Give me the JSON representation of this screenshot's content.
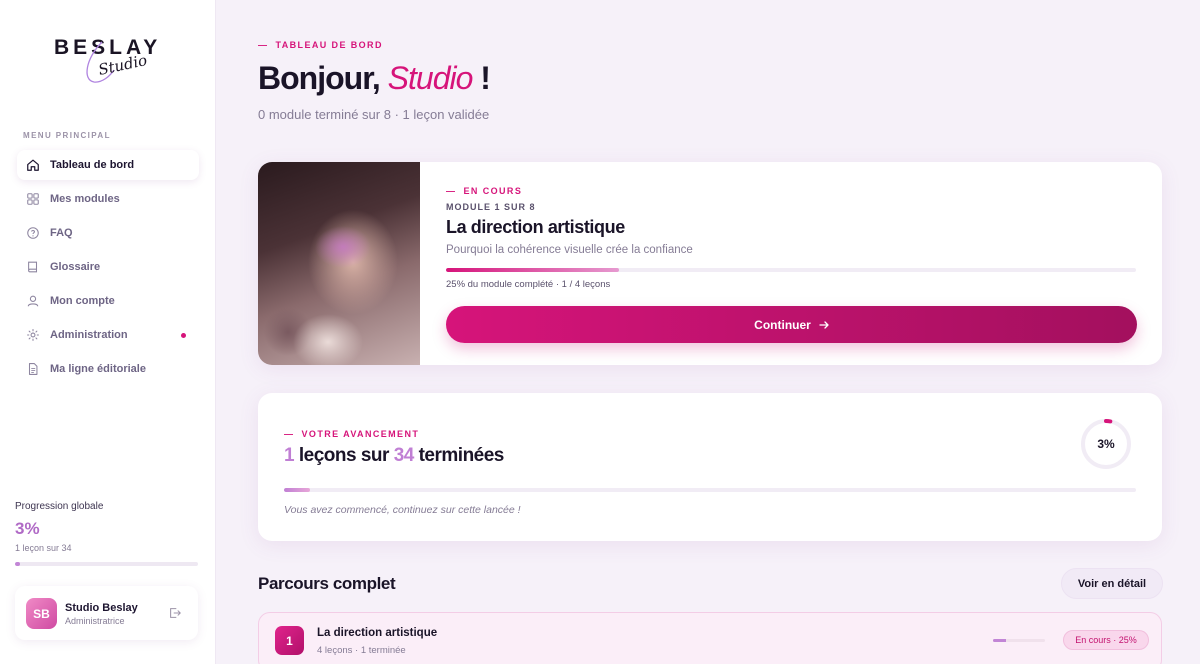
{
  "brand": {
    "wordmark": "BESLAY",
    "script": "Studio"
  },
  "sidebar": {
    "menu_title": "MENU PRINCIPAL",
    "items": [
      {
        "label": "Tableau de bord",
        "icon": "home-icon",
        "active": true
      },
      {
        "label": "Mes modules",
        "icon": "grid-icon"
      },
      {
        "label": "FAQ",
        "icon": "help-circle-icon"
      },
      {
        "label": "Glossaire",
        "icon": "book-icon"
      },
      {
        "label": "Mon compte",
        "icon": "user-icon"
      },
      {
        "label": "Administration",
        "icon": "settings-icon",
        "notification": true
      },
      {
        "label": "Ma ligne éditoriale",
        "icon": "document-icon"
      }
    ],
    "progress": {
      "label": "Progression globale",
      "value": "3%",
      "sub": "1 leçon sur 34",
      "fraction": 0.03
    },
    "user": {
      "initials": "SB",
      "name": "Studio Beslay",
      "role": "Administratrice"
    }
  },
  "header": {
    "eyebrow": "TABLEAU DE BORD",
    "greeting_prefix": "Bonjour, ",
    "greeting_name": "Studio",
    "greeting_suffix": " !",
    "summary": "0 module terminé sur 8 · 1 leçon validée"
  },
  "current_module": {
    "status": "EN COURS",
    "count": "MODULE 1 SUR 8",
    "title": "La direction artistique",
    "subtitle": "Pourquoi la cohérence visuelle crée la confiance",
    "progress_fraction": 0.25,
    "meta": "25% du module complété · 1 / 4 leçons",
    "cta_label": "Continuer"
  },
  "advancement": {
    "eyebrow": "VOTRE AVANCEMENT",
    "done": "1",
    "mid": " leçons sur ",
    "total": "34",
    "end": " terminées",
    "progress_fraction": 0.03,
    "percent": "3%",
    "note": "Vous avez commencé, continuez sur cette lancée !"
  },
  "parcours": {
    "title": "Parcours complet",
    "detail_label": "Voir en détail",
    "rows": [
      {
        "number": "1",
        "title": "La direction artistique",
        "meta": "4 leçons · 1 terminée",
        "progress_fraction": 0.25,
        "badge": "En cours · 25%"
      }
    ]
  },
  "colors": {
    "accent": "#d6147a",
    "accent_dark": "#a3105e",
    "lavender": "#c07fd4",
    "text": "#1a1428",
    "muted": "#857c95",
    "background": "#f6f1f9"
  }
}
